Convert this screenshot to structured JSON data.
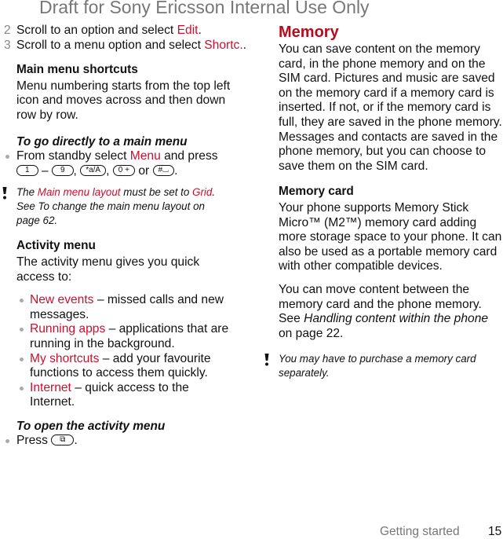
{
  "header": {
    "watermark": "Draft for Sony Ericsson Internal Use Only"
  },
  "left": {
    "steps": [
      {
        "num": "2",
        "pre": "Scroll to an option and select ",
        "link": "Edit",
        "post": "."
      },
      {
        "num": "3",
        "pre": "Scroll to a menu option and select ",
        "link": "Shortc.",
        "post": "."
      }
    ],
    "main_menu_shortcuts": {
      "heading": "Main menu shortcuts",
      "body": "Menu numbering starts from the top left icon and moves across and then down row by row."
    },
    "go_directly": {
      "heading": "To go directly to a main menu",
      "bullet_pre": "From standby select ",
      "bullet_link": "Menu",
      "bullet_post": " and press",
      "keys": [
        "1",
        "9",
        "*a/A",
        "0 +",
        "#⌴"
      ],
      "dash": "–",
      "comma": ",",
      "or": "or",
      "period": "."
    },
    "note1": {
      "pre": "The ",
      "link1": "Main menu layout",
      "mid": " must be set to ",
      "link2": "Grid",
      "post": ". See To change the main menu layout on page 62."
    },
    "activity_menu": {
      "heading": "Activity menu",
      "body": "The activity menu gives you quick access to:",
      "items": [
        {
          "link": "New events",
          "text": " – missed calls and new messages."
        },
        {
          "link": "Running apps",
          "text": " – applications that are running in the background."
        },
        {
          "link": "My shortcuts",
          "text": " – add your favourite functions to access them quickly."
        },
        {
          "link": "Internet",
          "text": " – quick access to the Internet."
        }
      ]
    },
    "open_activity": {
      "heading": "To open the activity menu",
      "bullet_pre": "Press",
      "key": "activity-key",
      "period": "."
    }
  },
  "right": {
    "memory": {
      "heading": "Memory",
      "body": "You can save content on the memory card, in the phone memory and on the SIM card. Pictures and music are saved on the memory card if a memory card is inserted. If not, or if the memory card is full, they are saved in the phone memory. Messages and contacts are saved in the phone memory, but you can choose to save them on the SIM card."
    },
    "memory_card": {
      "heading": "Memory card",
      "body": "Your phone supports Memory Stick Micro™ (M2™) memory card adding more storage space to your phone. It can also be used as a portable memory card with other compatible devices.",
      "body2_pre": "You can move content between the memory card and the phone memory. See ",
      "body2_ital": "Handling content within the phone",
      "body2_post": " on page 22."
    },
    "note2": "You may have to purchase a memory card separately."
  },
  "footer": {
    "section": "Getting started",
    "page": "15"
  },
  "colors": {
    "link_red": "#c8102e",
    "heading_red": "#b30d1f",
    "gray": "#777777"
  }
}
